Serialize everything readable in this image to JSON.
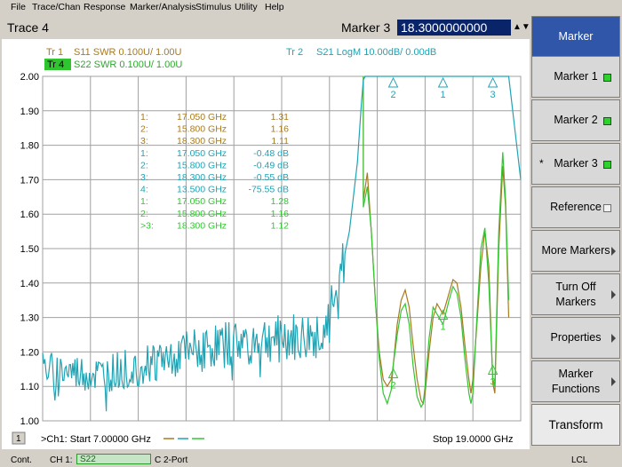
{
  "menu": [
    "File",
    "Trace/Chan",
    "Response",
    "Marker/Analysis",
    "Stimulus",
    "Utility",
    "Help"
  ],
  "header": {
    "trace_title": "Trace 4",
    "marker_label": "Marker 3",
    "marker_value": "18.3000000000 GHz"
  },
  "colors": {
    "s11": "#a87a1f",
    "s21": "#21a3b4",
    "s22": "#34c534",
    "grid": "#a0a0a0",
    "softkey_title": "#2f56a8"
  },
  "traces": [
    {
      "id": "Tr 1",
      "text": "S11 SWR 0.100U/  1.00U"
    },
    {
      "id": "Tr 4",
      "text": "S22 SWR 0.100U/  1.00U"
    },
    {
      "id": "Tr  2",
      "text": "S21 LogM 10.00dB/  0.00dB"
    }
  ],
  "marker_table": [
    {
      "n": "1:",
      "freq": "17.050 GHz",
      "val": "1.31",
      "trace": "s11"
    },
    {
      "n": "2:",
      "freq": "15.800 GHz",
      "val": "1.16",
      "trace": "s11"
    },
    {
      "n": "3:",
      "freq": "18.300 GHz",
      "val": "1.11",
      "trace": "s11"
    },
    {
      "n": "1:",
      "freq": "17.050 GHz",
      "val": "-0.48 dB",
      "trace": "s21"
    },
    {
      "n": "2:",
      "freq": "15.800 GHz",
      "val": "-0.49 dB",
      "trace": "s21"
    },
    {
      "n": "3:",
      "freq": "18.300 GHz",
      "val": "-0.55 dB",
      "trace": "s21"
    },
    {
      "n": "4:",
      "freq": "13.500 GHz",
      "val": "-75.55 dB",
      "trace": "s21"
    },
    {
      "n": "1:",
      "freq": "17.050 GHz",
      "val": "1.28",
      "trace": "s22"
    },
    {
      "n": "2:",
      "freq": "15.800 GHz",
      "val": "1.16",
      "trace": "s22"
    },
    {
      "n": ">3:",
      "freq": "18.300 GHz",
      "val": "1.12",
      "trace": "s22"
    }
  ],
  "chart_data": {
    "type": "line",
    "xlim": [
      7.0,
      19.0
    ],
    "ylim": [
      1.0,
      2.0
    ],
    "yticks": [
      "2.00",
      "1.90",
      "1.80",
      "1.70",
      "1.60",
      "1.50",
      "1.40",
      "1.30",
      "1.20",
      "1.10",
      "1.00"
    ],
    "grid": true,
    "series": [
      {
        "name": "S11",
        "trace": "s11",
        "points": [
          [
            15.05,
            1.64
          ],
          [
            15.15,
            1.72
          ],
          [
            15.25,
            1.55
          ],
          [
            15.35,
            1.35
          ],
          [
            15.45,
            1.2
          ],
          [
            15.55,
            1.12
          ],
          [
            15.65,
            1.1
          ],
          [
            15.75,
            1.12
          ],
          [
            15.8,
            1.16
          ],
          [
            15.9,
            1.28
          ],
          [
            16.0,
            1.35
          ],
          [
            16.1,
            1.38
          ],
          [
            16.2,
            1.33
          ],
          [
            16.3,
            1.22
          ],
          [
            16.4,
            1.12
          ],
          [
            16.5,
            1.06
          ],
          [
            16.55,
            1.05
          ],
          [
            16.6,
            1.08
          ],
          [
            16.7,
            1.2
          ],
          [
            16.8,
            1.3
          ],
          [
            16.9,
            1.34
          ],
          [
            17.05,
            1.31
          ],
          [
            17.2,
            1.37
          ],
          [
            17.3,
            1.41
          ],
          [
            17.4,
            1.4
          ],
          [
            17.5,
            1.33
          ],
          [
            17.6,
            1.22
          ],
          [
            17.7,
            1.12
          ],
          [
            17.75,
            1.08
          ],
          [
            17.8,
            1.12
          ],
          [
            17.9,
            1.28
          ],
          [
            18.0,
            1.45
          ],
          [
            18.1,
            1.55
          ],
          [
            18.2,
            1.45
          ],
          [
            18.3,
            1.11
          ],
          [
            18.35,
            1.08
          ],
          [
            18.45,
            1.5
          ],
          [
            18.55,
            1.74
          ],
          [
            18.62,
            1.62
          ],
          [
            18.7,
            1.3
          ]
        ]
      },
      {
        "name": "S22",
        "trace": "s22",
        "points": [
          [
            15.05,
            1.62
          ],
          [
            15.15,
            1.68
          ],
          [
            15.25,
            1.55
          ],
          [
            15.35,
            1.35
          ],
          [
            15.45,
            1.18
          ],
          [
            15.55,
            1.08
          ],
          [
            15.65,
            1.05
          ],
          [
            15.75,
            1.09
          ],
          [
            15.8,
            1.16
          ],
          [
            15.9,
            1.25
          ],
          [
            16.0,
            1.32
          ],
          [
            16.1,
            1.34
          ],
          [
            16.2,
            1.28
          ],
          [
            16.3,
            1.16
          ],
          [
            16.4,
            1.07
          ],
          [
            16.5,
            1.04
          ],
          [
            16.55,
            1.05
          ],
          [
            16.6,
            1.1
          ],
          [
            16.7,
            1.24
          ],
          [
            16.8,
            1.33
          ],
          [
            16.9,
            1.31
          ],
          [
            17.05,
            1.28
          ],
          [
            17.2,
            1.35
          ],
          [
            17.3,
            1.39
          ],
          [
            17.4,
            1.37
          ],
          [
            17.5,
            1.3
          ],
          [
            17.6,
            1.18
          ],
          [
            17.7,
            1.08
          ],
          [
            17.75,
            1.05
          ],
          [
            17.8,
            1.08
          ],
          [
            17.9,
            1.3
          ],
          [
            18.0,
            1.5
          ],
          [
            18.1,
            1.56
          ],
          [
            18.2,
            1.4
          ],
          [
            18.3,
            1.12
          ],
          [
            18.35,
            1.1
          ],
          [
            18.45,
            1.55
          ],
          [
            18.55,
            1.78
          ],
          [
            18.62,
            1.64
          ],
          [
            18.7,
            1.35
          ]
        ]
      },
      {
        "name": "S21",
        "trace": "s21",
        "noise": true,
        "points": [
          [
            7.0,
            1.15
          ],
          [
            8.5,
            1.13
          ],
          [
            10.0,
            1.18
          ],
          [
            11.5,
            1.22
          ],
          [
            13.0,
            1.24
          ],
          [
            13.5,
            1.23
          ],
          [
            14.0,
            1.26
          ],
          [
            14.4,
            1.35
          ],
          [
            14.7,
            1.55
          ],
          [
            14.9,
            1.75
          ],
          [
            15.0,
            1.92
          ],
          [
            15.05,
            1.99
          ],
          [
            15.1,
            2.0
          ],
          [
            18.7,
            2.0
          ],
          [
            18.8,
            1.9
          ],
          [
            18.9,
            1.8
          ],
          [
            19.0,
            1.7
          ]
        ]
      }
    ],
    "markers": [
      {
        "label": "2",
        "trace": "s21",
        "x": 15.8,
        "y": 1.995
      },
      {
        "label": "1",
        "trace": "s21",
        "x": 17.05,
        "y": 1.995
      },
      {
        "label": "3",
        "trace": "s21",
        "x": 18.3,
        "y": 1.995
      },
      {
        "label": "2",
        "trace": "s22",
        "x": 15.8,
        "y": 1.12
      },
      {
        "label": "1",
        "trace": "s22",
        "x": 17.05,
        "y": 1.29
      },
      {
        "label": "3",
        "trace": "s22",
        "x": 18.3,
        "y": 1.13
      }
    ],
    "footer": {
      "channel": "1",
      "start": ">Ch1: Start  7.00000 GHz",
      "stop": "Stop  19.0000 GHz"
    }
  },
  "softkeys": [
    {
      "label": "Marker",
      "title": true
    },
    {
      "label": "Marker 1",
      "led": "on"
    },
    {
      "label": "Marker 2",
      "led": "on"
    },
    {
      "label": "Marker 3",
      "led": "on",
      "prefix": "*"
    },
    {
      "label": "Reference",
      "led": "off"
    },
    {
      "label": "More Markers",
      "arrow": true
    },
    {
      "label": "Turn Off\nMarkers",
      "arrow": true
    },
    {
      "label": "Properties",
      "arrow": true
    },
    {
      "label": "Marker\nFunctions",
      "arrow": true
    },
    {
      "label": "Transform",
      "transform": true
    }
  ],
  "status": {
    "mode": "Cont.",
    "channel": "CH 1:",
    "port_trace": "S22",
    "cal": "C  2-Port",
    "remote": "LCL"
  }
}
